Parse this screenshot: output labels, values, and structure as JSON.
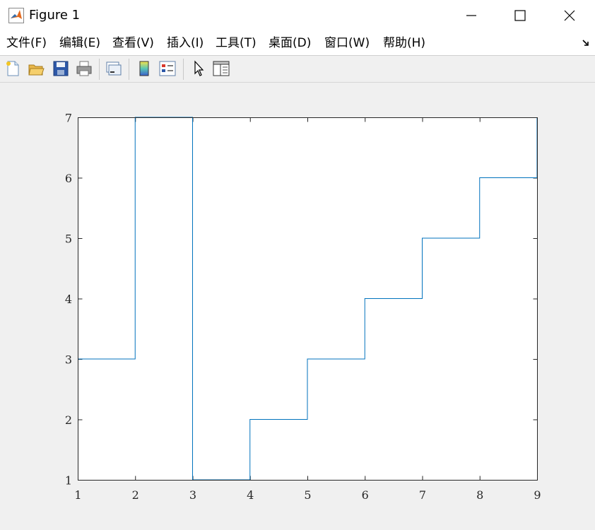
{
  "window": {
    "title": "Figure 1"
  },
  "menu": {
    "items": [
      "文件(F)",
      "编辑(E)",
      "查看(V)",
      "插入(I)",
      "工具(T)",
      "桌面(D)",
      "窗口(W)",
      "帮助(H)"
    ]
  },
  "toolbar": {
    "buttons": [
      "new-figure-icon",
      "open-file-icon",
      "save-icon",
      "print-icon",
      "link-plot-icon",
      "colorbar-icon",
      "legend-icon",
      "edit-plot-arrow-icon",
      "property-inspector-icon"
    ]
  },
  "colors": {
    "line": "#0072bd",
    "axes": "#262626",
    "figure_bg": "#f0f0f0"
  },
  "chart_data": {
    "type": "line",
    "style": "stairs",
    "x": [
      1,
      2,
      3,
      4,
      5,
      6,
      7,
      8,
      9
    ],
    "y": [
      3,
      7,
      1,
      2,
      3,
      4,
      5,
      6,
      7
    ],
    "xlim": [
      1,
      9
    ],
    "ylim": [
      1,
      7
    ],
    "xticks": [
      "1",
      "2",
      "3",
      "4",
      "5",
      "6",
      "7",
      "8",
      "9"
    ],
    "yticks": [
      "1",
      "2",
      "3",
      "4",
      "5",
      "6",
      "7"
    ],
    "grid": false,
    "title": "",
    "xlabel": "",
    "ylabel": ""
  }
}
